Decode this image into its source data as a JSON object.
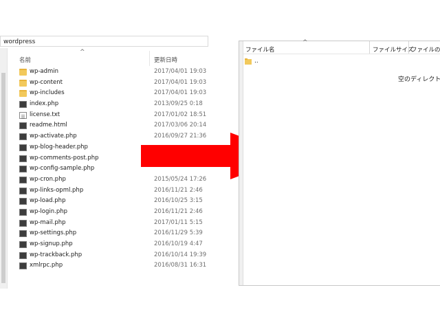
{
  "local": {
    "path": "wordpress",
    "columns": {
      "name": "名前",
      "date": "更新日時"
    },
    "files": [
      {
        "name": "wp-admin",
        "date": "2017/04/01 19:03",
        "icon": "folder-icon"
      },
      {
        "name": "wp-content",
        "date": "2017/04/01 19:03",
        "icon": "folder-icon"
      },
      {
        "name": "wp-includes",
        "date": "2017/04/01 19:03",
        "icon": "folder-icon"
      },
      {
        "name": "index.php",
        "date": "2013/09/25 0:18",
        "icon": "php-file-icon"
      },
      {
        "name": "license.txt",
        "date": "2017/01/02 18:51",
        "icon": "text-file-icon"
      },
      {
        "name": "readme.html",
        "date": "2017/03/06 20:14",
        "icon": "html-file-icon"
      },
      {
        "name": "wp-activate.php",
        "date": "2016/09/27 21:36",
        "icon": "php-file-icon"
      },
      {
        "name": "wp-blog-header.php",
        "date": "",
        "icon": "php-file-icon"
      },
      {
        "name": "wp-comments-post.php",
        "date": "",
        "icon": "php-file-icon"
      },
      {
        "name": "wp-config-sample.php",
        "date": "",
        "icon": "php-file-icon"
      },
      {
        "name": "wp-cron.php",
        "date": "2015/05/24 17:26",
        "icon": "php-file-icon"
      },
      {
        "name": "wp-links-opml.php",
        "date": "2016/11/21 2:46",
        "icon": "php-file-icon"
      },
      {
        "name": "wp-load.php",
        "date": "2016/10/25 3:15",
        "icon": "php-file-icon"
      },
      {
        "name": "wp-login.php",
        "date": "2016/11/21 2:46",
        "icon": "php-file-icon"
      },
      {
        "name": "wp-mail.php",
        "date": "2017/01/11 5:15",
        "icon": "php-file-icon"
      },
      {
        "name": "wp-settings.php",
        "date": "2016/11/29 5:39",
        "icon": "php-file-icon"
      },
      {
        "name": "wp-signup.php",
        "date": "2016/10/19 4:47",
        "icon": "php-file-icon"
      },
      {
        "name": "wp-trackback.php",
        "date": "2016/10/14 19:39",
        "icon": "php-file-icon"
      },
      {
        "name": "xmlrpc.php",
        "date": "2016/08/31 16:31",
        "icon": "php-file-icon"
      }
    ]
  },
  "remote": {
    "columns": {
      "name": "ファイル名",
      "size": "ファイルサイズ",
      "type": "ファイルの種類"
    },
    "parent_entry": "..",
    "empty_message": "空のディレクトリー"
  },
  "arrow": {
    "color": "#ff0000"
  }
}
